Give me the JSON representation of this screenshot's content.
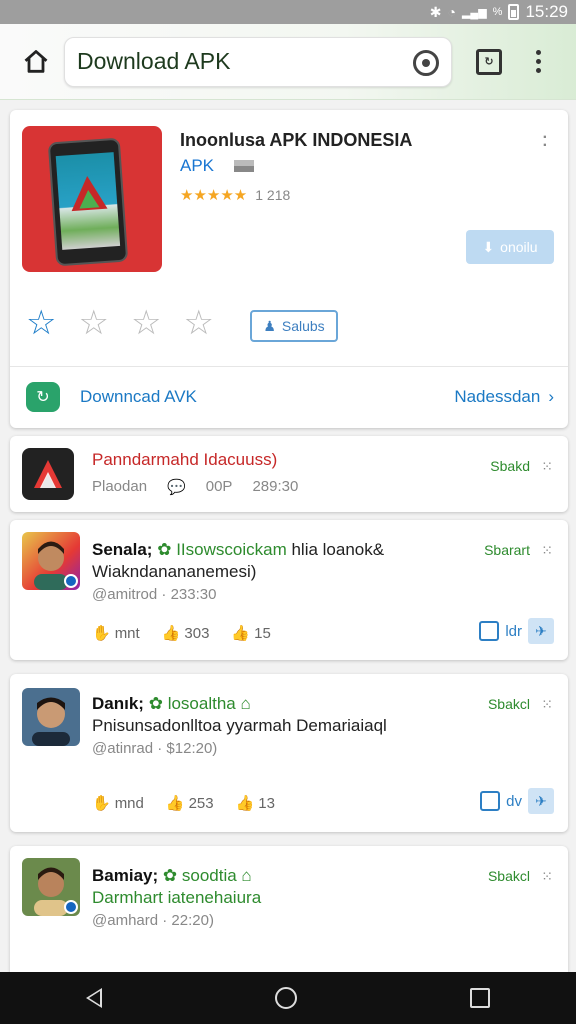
{
  "status_bar": {
    "time": "15:29",
    "battery_text": "%"
  },
  "address_bar": {
    "url": "Download APK"
  },
  "app": {
    "title": "Inoonlusa APK INDONESIA",
    "subtitle": "APK",
    "rating_count": "1 218",
    "install_label": "onoilu",
    "user_rating": 1,
    "review_label": "Salubs",
    "download_label": "Downncad AVK",
    "download_more": "Nadessdan"
  },
  "items": [
    {
      "title": "Panndarmahd Idacuuss)",
      "title_color": "#c62828",
      "meta_a": "Plaodan",
      "meta_b": "00P",
      "meta_c": "289:30",
      "status": "Sbakd"
    },
    {
      "name": "Senala;",
      "tag": "IIsowscoickam",
      "line1_rest": "hlia loanok&",
      "line2": "Wiakndanananemesi)",
      "meta": "@amitrod · 233:30",
      "status": "Sbarart",
      "stat1": "mnt",
      "stat2": "303",
      "stat3": "15",
      "action_label": "ldr"
    },
    {
      "name": "Danık;",
      "tag": "losoaltha",
      "line2": "Pnisunsadonlltoa yyarmah Demariaiaql",
      "meta": "@atinrad · $12:20)",
      "status": "Sbakcl",
      "stat1": "mnd",
      "stat2": "253",
      "stat3": "13",
      "action_label": "dv"
    },
    {
      "name": "Bamiay;",
      "tag": "soodtia",
      "line2": "Darmhart iatenehaiura",
      "meta": "@amhard · 22:20)",
      "status": "Sbakcl"
    }
  ]
}
